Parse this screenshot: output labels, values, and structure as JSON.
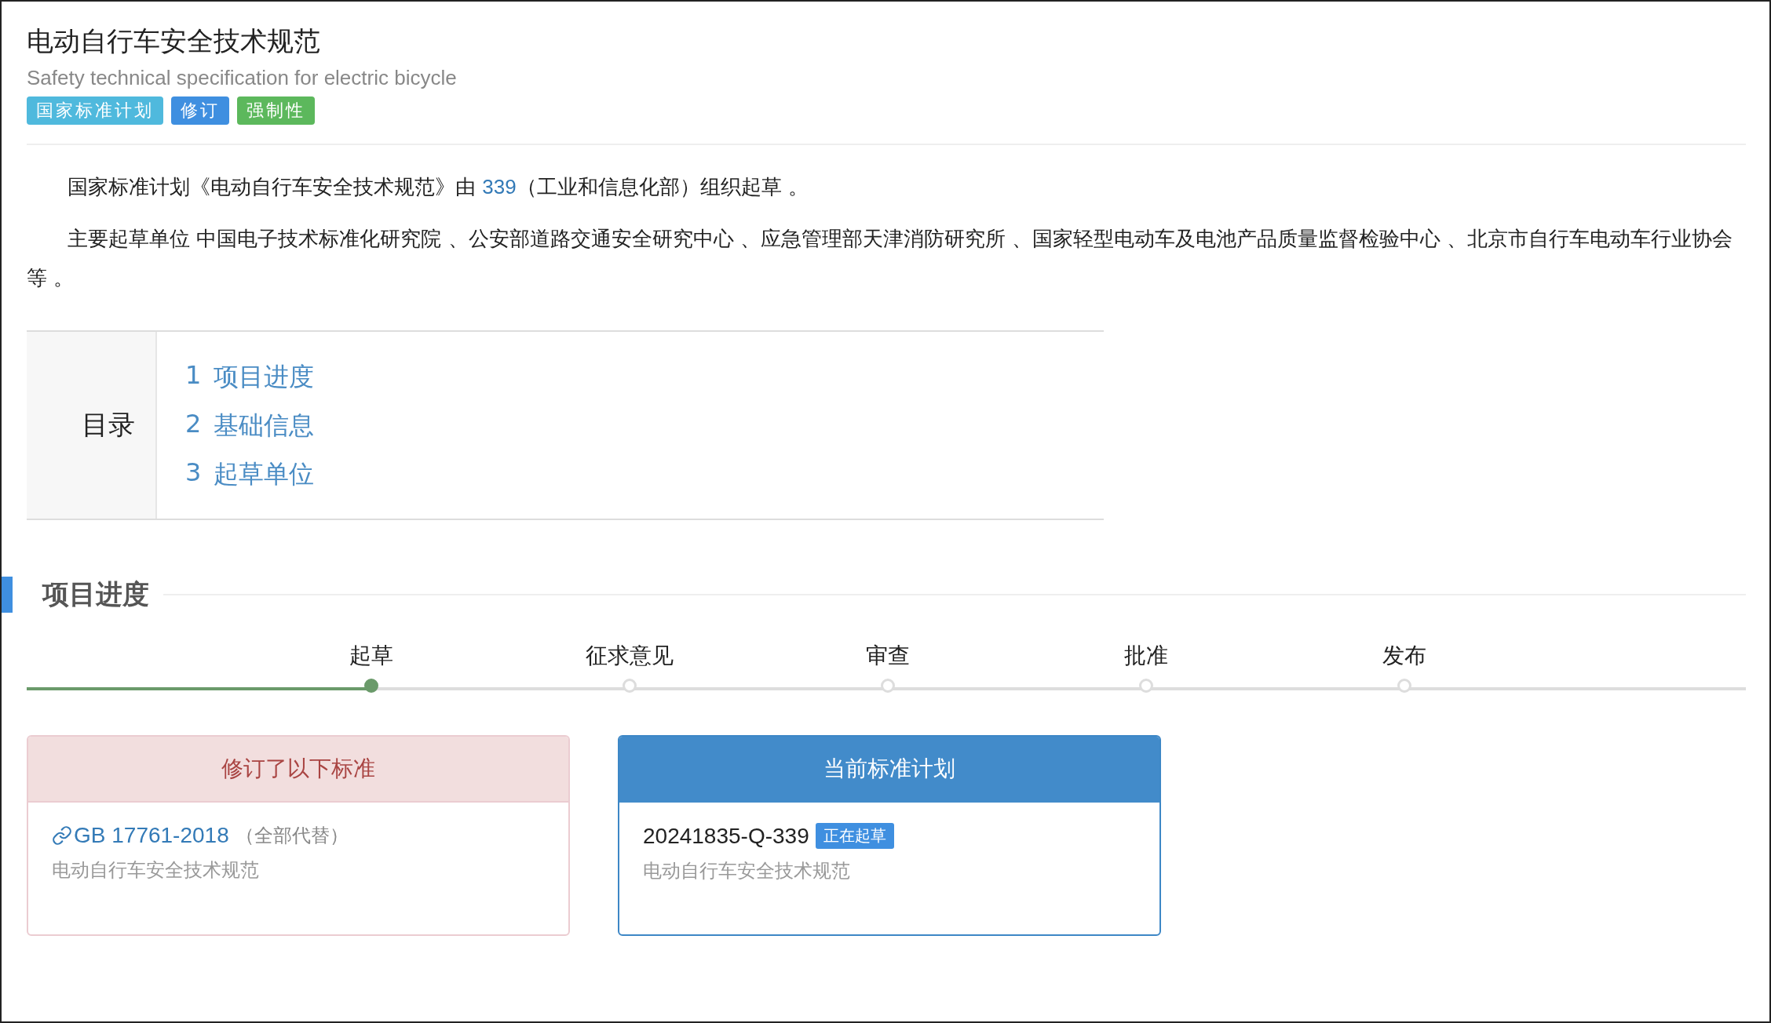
{
  "header": {
    "title": "电动自行车安全技术规范",
    "subtitle": "Safety technical specification for electric bicycle",
    "tags": [
      {
        "label": "国家标准计划",
        "color": "#4fb9dd"
      },
      {
        "label": "修订",
        "color": "#3f8fe0"
      },
      {
        "label": "强制性",
        "color": "#5cb85c"
      }
    ]
  },
  "intro": {
    "before": "国家标准计划《电动自行车安全技术规范》由 ",
    "link": "339",
    "after": "（工业和信息化部）组织起草 。"
  },
  "drafters": "主要起草单位 中国电子技术标准化研究院 、公安部道路交通安全研究中心 、应急管理部天津消防研究所 、国家轻型电动车及电池产品质量监督检验中心 、北京市自行车电动车行业协会等 。",
  "toc": {
    "label": "目录",
    "items": [
      {
        "number": "1",
        "text": "项目进度"
      },
      {
        "number": "2",
        "text": "基础信息"
      },
      {
        "number": "3",
        "text": "起草单位"
      }
    ]
  },
  "section": {
    "title": "项目进度"
  },
  "steps": [
    {
      "label": "起草",
      "selected": true
    },
    {
      "label": "征求意见",
      "selected": false
    },
    {
      "label": "审查",
      "selected": false
    },
    {
      "label": "批准",
      "selected": false
    },
    {
      "label": "发布",
      "selected": false
    }
  ],
  "cards": [
    {
      "kind": "revised",
      "title": "修订了以下标准",
      "code": "GB 17761-2018",
      "note": "（全部代替）",
      "name": "电动自行车安全技术规范"
    },
    {
      "kind": "current",
      "title": "当前标准计划",
      "code": "20241835-Q-339",
      "status": "正在起草",
      "name": "电动自行车安全技术规范"
    }
  ]
}
